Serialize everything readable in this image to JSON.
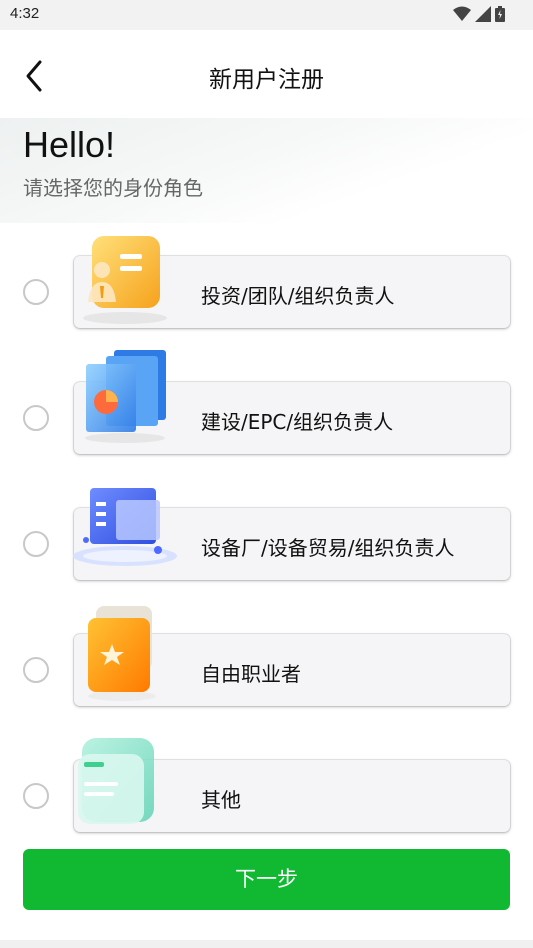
{
  "status_bar": {
    "time": "4:32"
  },
  "header": {
    "title": "新用户注册"
  },
  "intro": {
    "greeting": "Hello!",
    "subtitle": "请选择您的身份角色"
  },
  "options": [
    {
      "label": "投资/团队/组织负责人",
      "icon": "id-card-icon",
      "selected": false
    },
    {
      "label": "建设/EPC/组织负责人",
      "icon": "chart-board-icon",
      "selected": false
    },
    {
      "label": "设备厂/设备贸易/组织负责人",
      "icon": "factory-box-icon",
      "selected": false
    },
    {
      "label": "自由职业者",
      "icon": "star-book-icon",
      "selected": false
    },
    {
      "label": "其他",
      "icon": "folder-icon",
      "selected": false
    }
  ],
  "next_button": {
    "label": "下一步",
    "color": "#11b933"
  }
}
